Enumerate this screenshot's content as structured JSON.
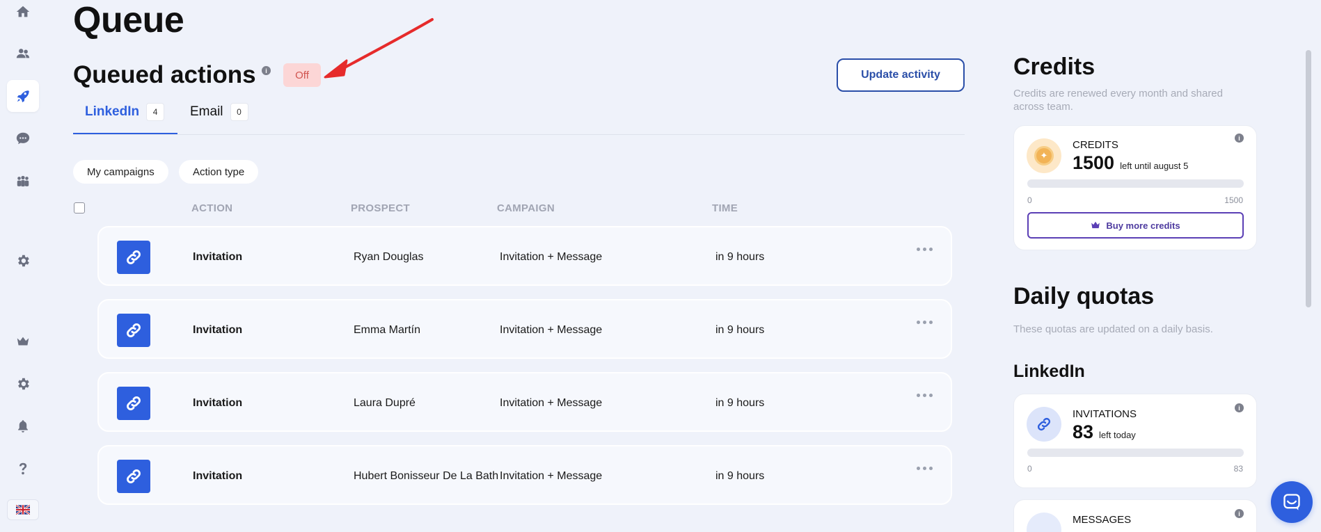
{
  "page": {
    "title": "Queue"
  },
  "queued": {
    "title": "Queued actions",
    "status": "Off",
    "update_label": "Update activity"
  },
  "tabs": [
    {
      "label": "LinkedIn",
      "count": "4"
    },
    {
      "label": "Email",
      "count": "0"
    }
  ],
  "filters": [
    "My campaigns",
    "Action type"
  ],
  "columns": {
    "action": "ACTION",
    "prospect": "PROSPECT",
    "campaign": "CAMPAIGN",
    "time": "TIME"
  },
  "rows": [
    {
      "action": "Invitation",
      "prospect": "Ryan Douglas",
      "campaign": "Invitation + Message",
      "time": "in 9 hours"
    },
    {
      "action": "Invitation",
      "prospect": "Emma Martín",
      "campaign": "Invitation + Message",
      "time": "in 9 hours"
    },
    {
      "action": "Invitation",
      "prospect": "Laura Dupré",
      "campaign": "Invitation + Message",
      "time": "in 9 hours"
    },
    {
      "action": "Invitation",
      "prospect": "Hubert Bonisseur De La Bath",
      "campaign": "Invitation + Message",
      "time": "in 9 hours"
    }
  ],
  "credits": {
    "title": "Credits",
    "subtitle_line1": "Credits are renewed every month and shared",
    "subtitle_line2": "across team.",
    "label": "CREDITS",
    "value": "1500",
    "suffix": "left until august 5",
    "scale_min": "0",
    "scale_max": "1500",
    "buy_label": "Buy more credits"
  },
  "quotas": {
    "title": "Daily quotas",
    "subtitle": "These quotas are updated on a daily basis.",
    "linkedin_title": "LinkedIn",
    "invitations": {
      "label": "INVITATIONS",
      "value": "83",
      "suffix": "left today",
      "scale_min": "0",
      "scale_max": "83"
    },
    "messages": {
      "label": "MESSAGES"
    }
  },
  "colors": {
    "accent": "#2e5fde",
    "off_bg": "#fcd6d6",
    "off_text": "#d0544f",
    "buy_border": "#5b3fb5"
  },
  "icons": {
    "sidebar": [
      "home-icon",
      "users-icon",
      "rocket-icon",
      "chat-icon",
      "team-icon",
      "gear-icon",
      "crown-icon",
      "settings-icon",
      "bell-icon",
      "help-icon",
      "uk-flag-icon"
    ]
  }
}
